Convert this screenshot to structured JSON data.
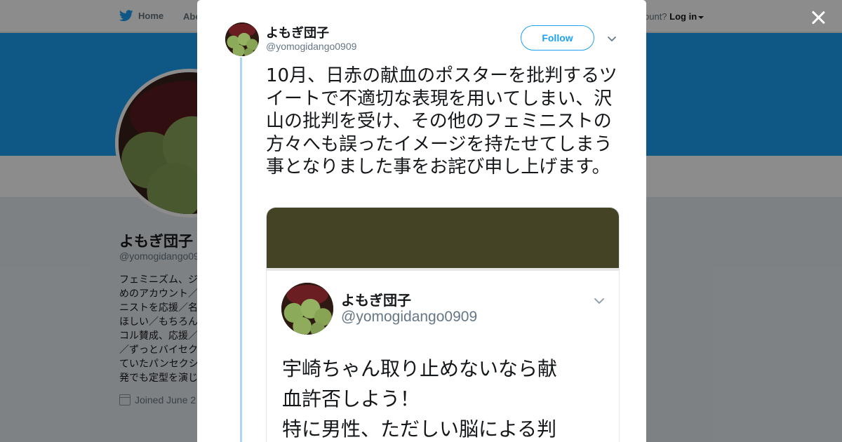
{
  "nav": {
    "home_label": "Home",
    "about_label": "Abo",
    "account_prompt": "ccount?",
    "login_label": "Log in"
  },
  "profile": {
    "name": "よもぎ団子",
    "handle": "@yomogidango09",
    "bio_lines": [
      "フェミニズム、ジ",
      "めのアカウント／",
      "ニストを応援／名",
      "ほしい／もちろん",
      "コル賛成、応援／",
      "／ずっとバイセク",
      "ていたパンセクシ",
      "発でも定型を演じ"
    ],
    "joined": "Joined June 2"
  },
  "tweet": {
    "author_name": "よもぎ団子",
    "author_handle": "@yomogidango0909",
    "follow_label": "Follow",
    "text": "10月、日赤の献血のポスターを批判するツイートで不適切な表現を用いてしまい、沢山の批判を受け、その他のフェミニストの方々へも誤ったイメージを持たせてしまう事となりました事をお詫び申し上げます。"
  },
  "quoted": {
    "author_name": "よもぎ団子",
    "author_handle": "@yomogidango0909",
    "lines": [
      "宇崎ちゃん取り止めないなら献",
      "血許否しよう！",
      "特に男性、ただしい脳による判"
    ]
  },
  "colors": {
    "brand_blue": "#1da1f2",
    "banner": "#1da1f2",
    "media_dark": "#454325"
  },
  "icons": [
    "twitter-bird-icon",
    "close-icon",
    "chevron-down-icon",
    "calendar-icon"
  ]
}
